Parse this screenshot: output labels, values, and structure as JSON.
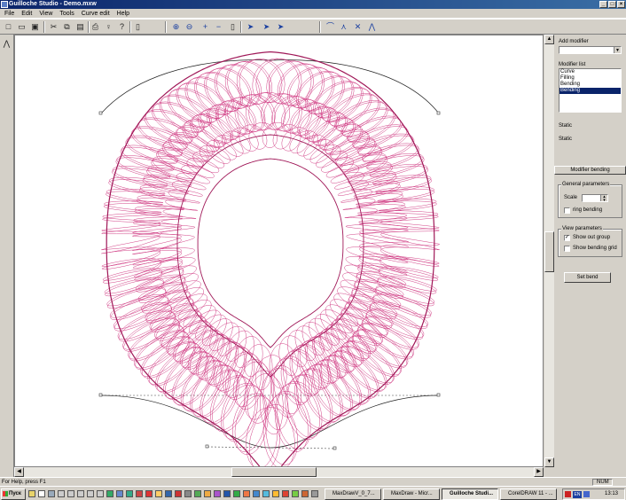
{
  "window": {
    "title": "Guilloche Studio - Demo.mxw"
  },
  "menu": [
    "File",
    "Edit",
    "View",
    "Tools",
    "Curve edit",
    "Help"
  ],
  "toolbar_icons": [
    "new-file-icon",
    "open-file-icon",
    "save-icon",
    "cut-icon",
    "copy-icon",
    "paste-icon",
    "print-preview-icon",
    "light-bulb-icon",
    "help-cursor-icon",
    "frame-icon",
    "zoom-in-icon",
    "zoom-out-icon",
    "plus-icon",
    "minus-icon",
    "page-icon",
    "select-arrow-icon",
    "node-arrow-icon",
    "solid-arrow-icon",
    "curve-tool-1-icon",
    "curve-tool-2-icon",
    "curve-tool-3-icon",
    "curve-tool-4-icon"
  ],
  "panel": {
    "add_modifier_label": "Add modifier",
    "add_modifier_value": "",
    "modifier_list_label": "Modifier list",
    "modifiers": [
      "Curve",
      "Filling",
      "Bending",
      "Bending"
    ],
    "selected_modifier_index": 3,
    "static1": "Static",
    "static2": "Static",
    "modifier_title": "Modifier bending",
    "general_params_label": "General parameters",
    "scale_label": "Scale",
    "scale_value": "",
    "ring_bending_label": "ring bending",
    "ring_bending_checked": false,
    "view_params_label": "View parameters",
    "show_out_group_label": "Show out group",
    "show_out_group_checked": true,
    "show_bending_grid_label": "Show bending grid",
    "show_bending_grid_checked": false,
    "set_bend_label": "Set bend"
  },
  "status": {
    "help_text": "For Help, press F1",
    "num": "NUM"
  },
  "taskbar": {
    "start_label": "Пуск",
    "tasks": [
      "MaxDrawV_0_7...",
      "MaxDraw - Micr...",
      "Guilloche Studi...",
      "CorelDRAW 11 - ..."
    ],
    "active_task_index": 2,
    "lang": "EN",
    "clock": "13:13"
  },
  "colors": {
    "curve": "#cc2a78",
    "curve_dark": "#a01858",
    "selection": "#0a246a"
  }
}
